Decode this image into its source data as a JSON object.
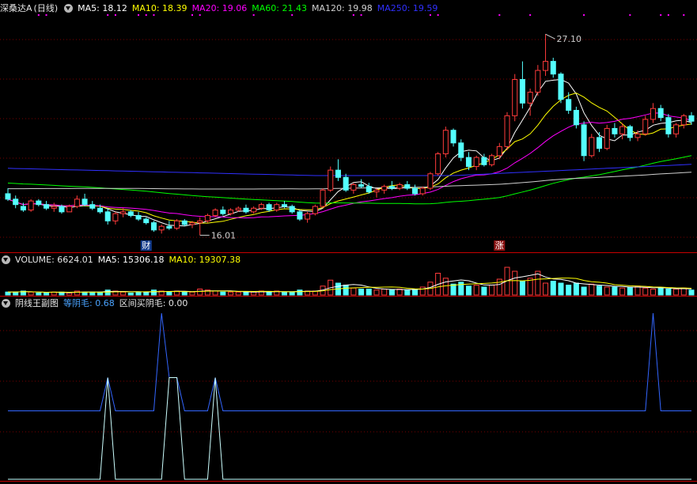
{
  "stock": {
    "name": "深桑达A",
    "period": "(日线)",
    "ma": [
      {
        "label": "MA5: 18.12",
        "color": "#ffffff"
      },
      {
        "label": "MA10: 18.39",
        "color": "#ffff00"
      },
      {
        "label": "MA20: 19.06",
        "color": "#ff00ff"
      },
      {
        "label": "MA60: 21.43",
        "color": "#00ff00"
      },
      {
        "label": "MA120: 19.98",
        "color": "#d0d0d0"
      },
      {
        "label": "MA250: 19.59",
        "color": "#3030ff"
      }
    ],
    "high_label": "27.10",
    "low_label": "16.01",
    "marker_cai": "财",
    "marker_zhang": "涨"
  },
  "volume_panel": {
    "title": "VOLUME: 6624.01",
    "ma5": "MA5: 15306.18",
    "ma10": "MA10: 19307.38"
  },
  "indicator_panel": {
    "title": "阴线王副图",
    "yinmao": "等阴毛: 0.68",
    "mai": "区间买阴毛: 0.00"
  },
  "colors": {
    "up": "#ff3b3b",
    "down": "#54ffff",
    "ma5": "#ffffff",
    "ma10": "#ffff00",
    "ma20": "#ff00ff",
    "ma60": "#00ff00",
    "ma120": "#d0d0d0",
    "ma250": "#3030ff",
    "ind_high": "#ccffff",
    "ind_base": "#3366ff"
  },
  "chart_data": {
    "type": "candlestick",
    "price_range": [
      15.2,
      28.2
    ],
    "candles": [
      {
        "o": 18.3,
        "h": 18.6,
        "l": 17.9,
        "c": 18.0
      },
      {
        "o": 18.0,
        "h": 18.2,
        "l": 17.5,
        "c": 17.7
      },
      {
        "o": 17.6,
        "h": 17.8,
        "l": 17.3,
        "c": 17.4
      },
      {
        "o": 17.4,
        "h": 18.0,
        "l": 17.3,
        "c": 17.9
      },
      {
        "o": 17.9,
        "h": 18.0,
        "l": 17.6,
        "c": 17.7
      },
      {
        "o": 17.7,
        "h": 17.9,
        "l": 17.4,
        "c": 17.5
      },
      {
        "o": 17.5,
        "h": 17.8,
        "l": 17.3,
        "c": 17.6
      },
      {
        "o": 17.6,
        "h": 17.7,
        "l": 17.2,
        "c": 17.3
      },
      {
        "o": 17.3,
        "h": 17.7,
        "l": 17.3,
        "c": 17.6
      },
      {
        "o": 17.6,
        "h": 18.2,
        "l": 17.5,
        "c": 18.0
      },
      {
        "o": 18.0,
        "h": 18.3,
        "l": 17.6,
        "c": 17.7
      },
      {
        "o": 17.7,
        "h": 17.9,
        "l": 17.4,
        "c": 17.5
      },
      {
        "o": 17.5,
        "h": 17.7,
        "l": 17.2,
        "c": 17.3
      },
      {
        "o": 17.3,
        "h": 17.5,
        "l": 16.6,
        "c": 16.8
      },
      {
        "o": 16.8,
        "h": 17.3,
        "l": 16.6,
        "c": 17.2
      },
      {
        "o": 17.2,
        "h": 17.5,
        "l": 17.0,
        "c": 17.3
      },
      {
        "o": 17.3,
        "h": 17.4,
        "l": 17.0,
        "c": 17.1
      },
      {
        "o": 17.1,
        "h": 17.3,
        "l": 16.8,
        "c": 16.9
      },
      {
        "o": 16.9,
        "h": 17.0,
        "l": 16.6,
        "c": 16.7
      },
      {
        "o": 16.7,
        "h": 16.8,
        "l": 16.2,
        "c": 16.3
      },
      {
        "o": 16.3,
        "h": 16.6,
        "l": 16.1,
        "c": 16.5
      },
      {
        "o": 16.5,
        "h": 16.8,
        "l": 16.3,
        "c": 16.4
      },
      {
        "o": 16.4,
        "h": 16.9,
        "l": 16.3,
        "c": 16.8
      },
      {
        "o": 16.8,
        "h": 16.9,
        "l": 16.5,
        "c": 16.6
      },
      {
        "o": 16.6,
        "h": 16.8,
        "l": 16.4,
        "c": 16.7
      },
      {
        "o": 16.7,
        "h": 17.0,
        "l": 16.01,
        "c": 16.8
      },
      {
        "o": 16.8,
        "h": 17.2,
        "l": 16.7,
        "c": 17.1
      },
      {
        "o": 17.1,
        "h": 17.5,
        "l": 17.0,
        "c": 17.4
      },
      {
        "o": 17.4,
        "h": 17.6,
        "l": 17.1,
        "c": 17.2
      },
      {
        "o": 17.2,
        "h": 17.5,
        "l": 17.1,
        "c": 17.4
      },
      {
        "o": 17.4,
        "h": 17.6,
        "l": 17.3,
        "c": 17.5
      },
      {
        "o": 17.5,
        "h": 17.7,
        "l": 17.2,
        "c": 17.3
      },
      {
        "o": 17.3,
        "h": 17.6,
        "l": 17.2,
        "c": 17.5
      },
      {
        "o": 17.5,
        "h": 17.8,
        "l": 17.4,
        "c": 17.7
      },
      {
        "o": 17.7,
        "h": 17.8,
        "l": 17.3,
        "c": 17.4
      },
      {
        "o": 17.4,
        "h": 17.8,
        "l": 17.3,
        "c": 17.7
      },
      {
        "o": 17.7,
        "h": 17.9,
        "l": 17.5,
        "c": 17.6
      },
      {
        "o": 17.6,
        "h": 17.7,
        "l": 17.2,
        "c": 17.3
      },
      {
        "o": 17.3,
        "h": 17.4,
        "l": 16.8,
        "c": 16.9
      },
      {
        "o": 16.9,
        "h": 17.3,
        "l": 16.7,
        "c": 17.2
      },
      {
        "o": 17.2,
        "h": 17.7,
        "l": 17.1,
        "c": 17.6
      },
      {
        "o": 17.6,
        "h": 18.6,
        "l": 17.5,
        "c": 18.5
      },
      {
        "o": 18.5,
        "h": 19.8,
        "l": 18.4,
        "c": 19.6
      },
      {
        "o": 19.6,
        "h": 20.2,
        "l": 19.0,
        "c": 19.2
      },
      {
        "o": 19.2,
        "h": 19.4,
        "l": 18.4,
        "c": 18.5
      },
      {
        "o": 18.5,
        "h": 18.9,
        "l": 18.3,
        "c": 18.8
      },
      {
        "o": 18.8,
        "h": 19.1,
        "l": 18.6,
        "c": 18.7
      },
      {
        "o": 18.7,
        "h": 18.9,
        "l": 18.3,
        "c": 18.4
      },
      {
        "o": 18.4,
        "h": 18.6,
        "l": 18.1,
        "c": 18.5
      },
      {
        "o": 18.5,
        "h": 18.8,
        "l": 18.3,
        "c": 18.7
      },
      {
        "o": 18.7,
        "h": 19.0,
        "l": 18.5,
        "c": 18.6
      },
      {
        "o": 18.6,
        "h": 18.9,
        "l": 18.5,
        "c": 18.8
      },
      {
        "o": 18.8,
        "h": 19.0,
        "l": 18.5,
        "c": 18.6
      },
      {
        "o": 18.6,
        "h": 18.8,
        "l": 18.2,
        "c": 18.3
      },
      {
        "o": 18.3,
        "h": 18.7,
        "l": 18.2,
        "c": 18.6
      },
      {
        "o": 18.6,
        "h": 19.5,
        "l": 18.5,
        "c": 19.4
      },
      {
        "o": 19.4,
        "h": 20.6,
        "l": 19.3,
        "c": 20.5
      },
      {
        "o": 20.5,
        "h": 22.0,
        "l": 20.3,
        "c": 21.8
      },
      {
        "o": 21.8,
        "h": 21.9,
        "l": 20.9,
        "c": 21.1
      },
      {
        "o": 21.1,
        "h": 21.3,
        "l": 20.1,
        "c": 20.3
      },
      {
        "o": 20.3,
        "h": 20.6,
        "l": 19.6,
        "c": 19.8
      },
      {
        "o": 19.8,
        "h": 20.4,
        "l": 19.6,
        "c": 20.3
      },
      {
        "o": 20.3,
        "h": 20.5,
        "l": 19.8,
        "c": 19.9
      },
      {
        "o": 19.9,
        "h": 20.5,
        "l": 19.8,
        "c": 20.4
      },
      {
        "o": 20.4,
        "h": 21.1,
        "l": 20.2,
        "c": 20.9
      },
      {
        "o": 20.9,
        "h": 22.8,
        "l": 20.7,
        "c": 22.6
      },
      {
        "o": 22.6,
        "h": 24.9,
        "l": 22.3,
        "c": 24.6
      },
      {
        "o": 24.6,
        "h": 25.6,
        "l": 23.0,
        "c": 23.3
      },
      {
        "o": 23.3,
        "h": 24.1,
        "l": 22.6,
        "c": 23.9
      },
      {
        "o": 23.9,
        "h": 25.4,
        "l": 23.7,
        "c": 25.1
      },
      {
        "o": 25.1,
        "h": 27.1,
        "l": 24.8,
        "c": 25.6
      },
      {
        "o": 25.6,
        "h": 25.8,
        "l": 24.7,
        "c": 24.9
      },
      {
        "o": 24.9,
        "h": 25.0,
        "l": 23.3,
        "c": 23.5
      },
      {
        "o": 23.5,
        "h": 23.9,
        "l": 22.7,
        "c": 22.9
      },
      {
        "o": 22.9,
        "h": 23.1,
        "l": 21.9,
        "c": 22.1
      },
      {
        "o": 22.1,
        "h": 22.3,
        "l": 20.1,
        "c": 20.4
      },
      {
        "o": 20.4,
        "h": 21.6,
        "l": 20.3,
        "c": 21.4
      },
      {
        "o": 21.4,
        "h": 21.7,
        "l": 20.6,
        "c": 20.8
      },
      {
        "o": 20.8,
        "h": 22.1,
        "l": 20.7,
        "c": 21.9
      },
      {
        "o": 21.9,
        "h": 22.2,
        "l": 21.4,
        "c": 21.6
      },
      {
        "o": 21.6,
        "h": 22.2,
        "l": 21.3,
        "c": 22.0
      },
      {
        "o": 22.0,
        "h": 22.1,
        "l": 21.2,
        "c": 21.4
      },
      {
        "o": 21.4,
        "h": 21.8,
        "l": 21.2,
        "c": 21.6
      },
      {
        "o": 21.6,
        "h": 22.6,
        "l": 21.5,
        "c": 22.4
      },
      {
        "o": 22.4,
        "h": 23.3,
        "l": 22.2,
        "c": 23.0
      },
      {
        "o": 23.0,
        "h": 23.2,
        "l": 22.3,
        "c": 22.5
      },
      {
        "o": 22.5,
        "h": 22.7,
        "l": 21.4,
        "c": 21.6
      },
      {
        "o": 21.6,
        "h": 22.2,
        "l": 21.4,
        "c": 22.1
      },
      {
        "o": 22.1,
        "h": 22.7,
        "l": 21.9,
        "c": 22.6
      },
      {
        "o": 22.6,
        "h": 22.8,
        "l": 22.1,
        "c": 22.3
      }
    ],
    "volume": [
      3,
      3,
      4,
      3,
      2,
      2,
      3,
      3,
      2,
      4,
      3,
      3,
      3,
      5,
      4,
      3,
      2,
      3,
      3,
      5,
      4,
      3,
      4,
      3,
      3,
      6,
      5,
      4,
      3,
      3,
      3,
      3,
      3,
      4,
      3,
      4,
      3,
      3,
      5,
      4,
      4,
      9,
      15,
      12,
      10,
      7,
      6,
      6,
      5,
      6,
      5,
      6,
      5,
      6,
      8,
      13,
      22,
      17,
      11,
      13,
      9,
      10,
      8,
      10,
      16,
      28,
      24,
      14,
      17,
      24,
      12,
      14,
      12,
      10,
      12,
      8,
      11,
      9,
      8,
      8,
      7,
      8,
      9,
      7,
      6,
      7,
      6,
      6,
      7,
      5
    ],
    "indicator": {
      "range": [
        -1.4,
        2.0
      ],
      "base": 0.0,
      "spikes": [
        {
          "i": 13,
          "v": 0.68
        },
        {
          "i": 20,
          "v": 2.0
        },
        {
          "i": 21,
          "v": 0.68
        },
        {
          "i": 22,
          "v": 0.68
        },
        {
          "i": 27,
          "v": 0.68
        },
        {
          "i": 84,
          "v": 2.0
        }
      ],
      "dips": [
        {
          "from": 11,
          "to": 29
        }
      ]
    }
  }
}
